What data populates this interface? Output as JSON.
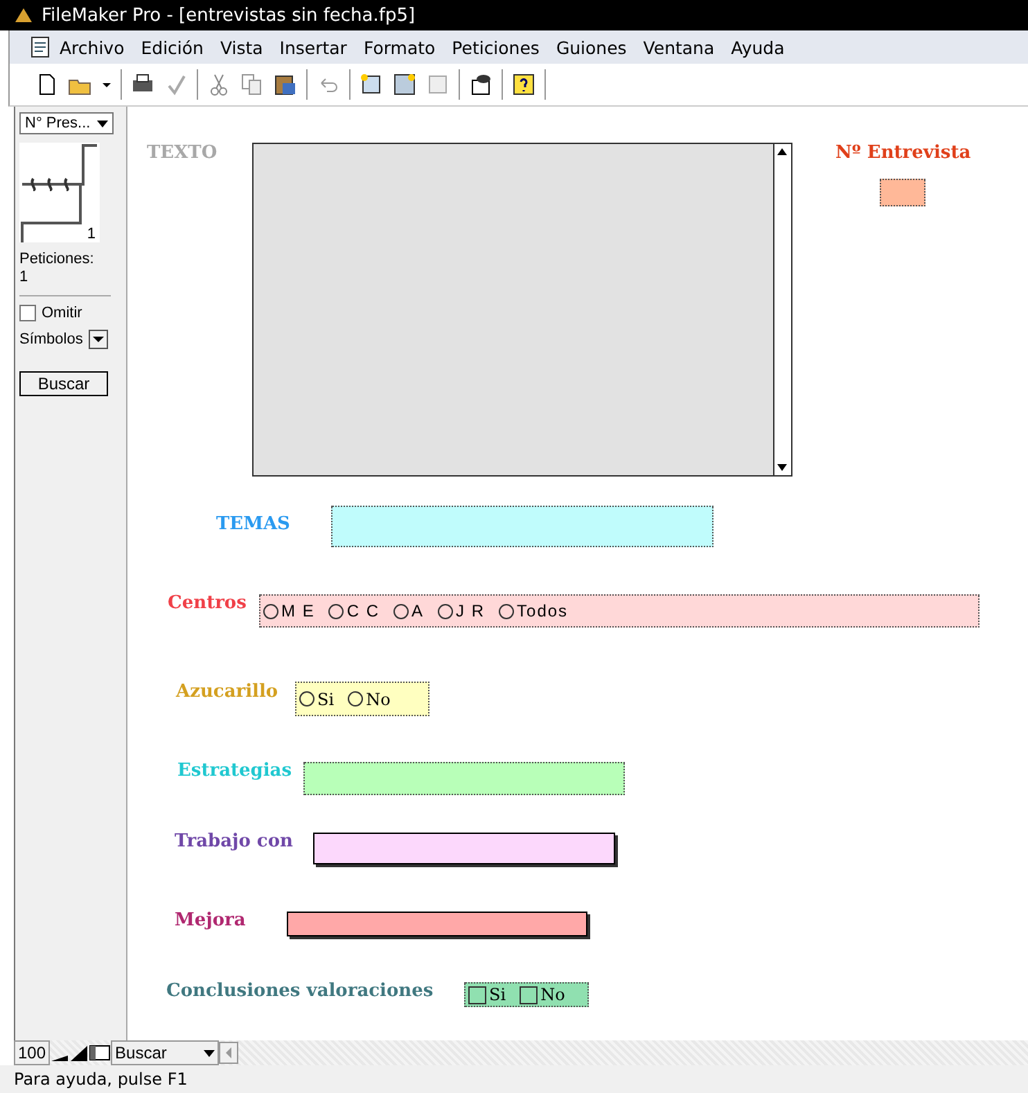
{
  "window": {
    "title": "FileMaker Pro - [entrevistas sin fecha.fp5]"
  },
  "menu": [
    "Archivo",
    "Edición",
    "Vista",
    "Insertar",
    "Formato",
    "Peticiones",
    "Guiones",
    "Ventana",
    "Ayuda"
  ],
  "sidebar": {
    "layout_menu": "N° Pres...",
    "page_number": "1",
    "requests_label": "Peticiones:",
    "requests_count": "1",
    "omit": {
      "label": "Omitir",
      "checked": false
    },
    "symbols": "Símbolos",
    "find_button": "Buscar"
  },
  "fields": [
    {
      "kind": "text_area",
      "label": "TEXTO",
      "color": "#a8a8a8"
    },
    {
      "kind": "text",
      "label": "Nº Entrevista",
      "color": "#e0401a"
    },
    {
      "kind": "text",
      "label": "TEMAS",
      "color": "#2a9af0"
    },
    {
      "kind": "radio",
      "label": "Centros",
      "color": "#f04048",
      "options": [
        {
          "label": "M E",
          "selected": false
        },
        {
          "label": "C C",
          "selected": false
        },
        {
          "label": "A",
          "selected": false
        },
        {
          "label": "J R",
          "selected": false
        },
        {
          "label": "Todos",
          "selected": false
        }
      ]
    },
    {
      "kind": "radio",
      "label": "Azucarillo",
      "color": "#d4a020",
      "options": [
        {
          "label": "Si",
          "selected": false
        },
        {
          "label": "No",
          "selected": false
        }
      ]
    },
    {
      "kind": "text",
      "label": "Estrategias",
      "color": "#20c8d0"
    },
    {
      "kind": "text",
      "label": "Trabajo con",
      "color": "#7048a8"
    },
    {
      "kind": "text",
      "label": "Mejora",
      "color": "#b02870"
    },
    {
      "kind": "checkbox",
      "label": "Conclusiones valoraciones",
      "color": "#407880",
      "options": [
        {
          "label": "Si",
          "checked": false
        },
        {
          "label": "No",
          "checked": false
        }
      ]
    }
  ],
  "bottom_bar": {
    "zoom": "100",
    "mode": "Buscar"
  },
  "status_bar": "Para ayuda, pulse F1"
}
